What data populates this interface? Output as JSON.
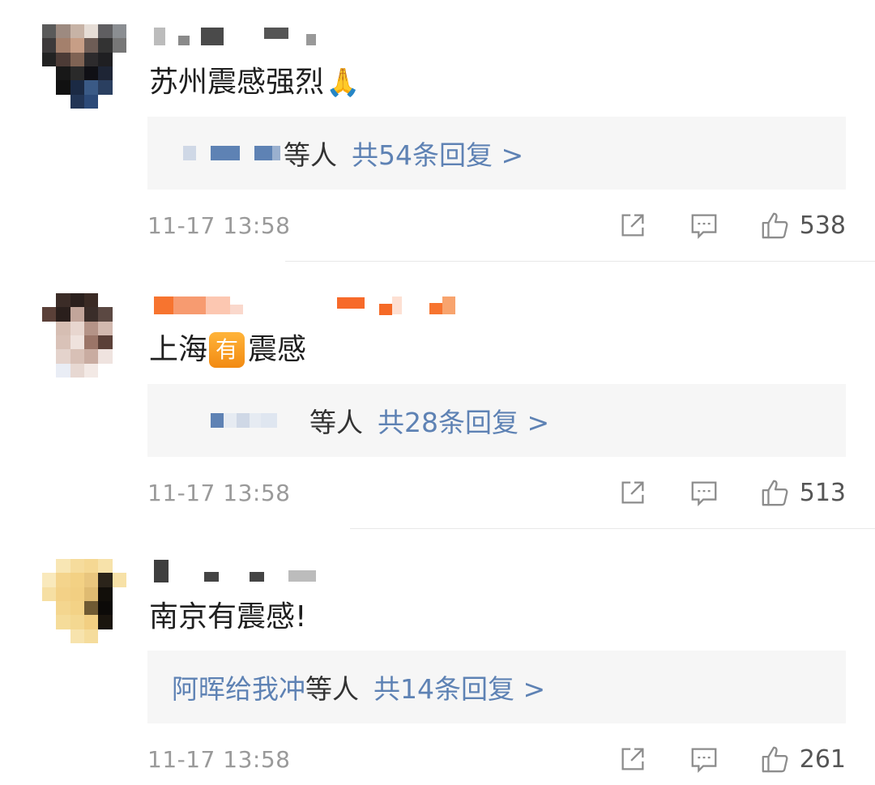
{
  "comments": [
    {
      "text": "苏州震感强烈",
      "emoji": "🙏",
      "reply_who": "等人",
      "reply_count": "共54条回复 >",
      "time": "11-17 13:58",
      "likes": "538"
    },
    {
      "text_before": "上海",
      "badge": "有",
      "text_after": "震感",
      "reply_who": "等人",
      "reply_count": "共28条回复 >",
      "time": "11-17 13:58",
      "likes": "513"
    },
    {
      "text": "南京有震感!",
      "reply_who_blue": "阿晖给我冲",
      "reply_who": "等人",
      "reply_count": "共14条回复 >",
      "time": "11-17 13:58",
      "likes": "261"
    }
  ],
  "icons": {
    "share": "share-icon",
    "reply": "comment-icon",
    "like": "thumbs-up-icon"
  },
  "colors": {
    "link": "#5e82b4",
    "reply_bg": "#f6f6f6",
    "meta": "#9a9a9a"
  }
}
